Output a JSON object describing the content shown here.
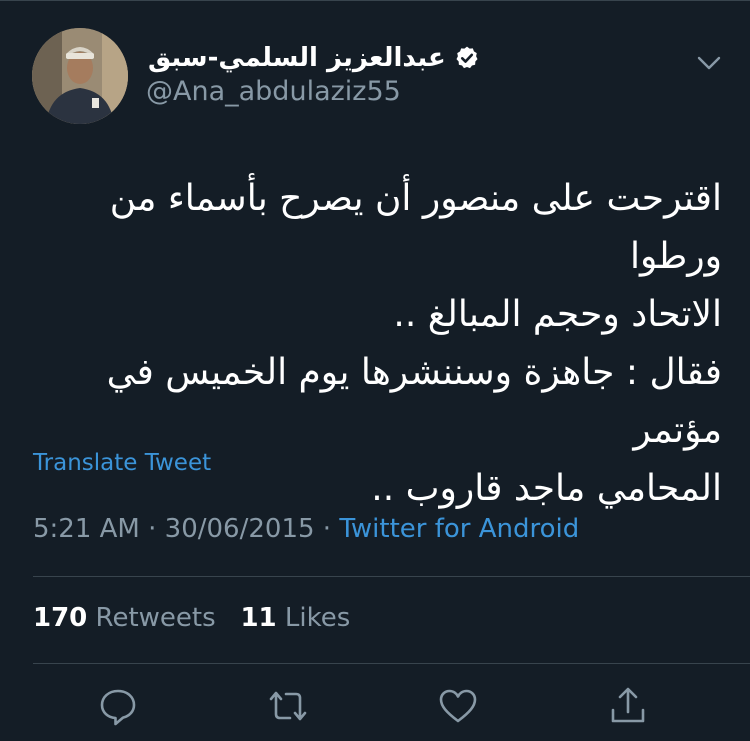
{
  "colors": {
    "background": "#141d26",
    "text": "#ffffff",
    "secondary_text": "#8899a6",
    "link": "#3b94d9",
    "divider": "#38444d"
  },
  "author": {
    "display_name": "عبدالعزيز السلمي-سبق",
    "handle": "@Ana_abdulaziz55",
    "verified": true,
    "avatar_icon": "profile-photo"
  },
  "tweet": {
    "text": "اقترحت على منصور أن يصرح بأسماء من ورطوا\nالاتحاد وحجم المبالغ ..\nفقال : جاهزة وسننشرها يوم الخميس في مؤتمر\nالمحامي ماجد قاروب ..",
    "translate_label": "Translate Tweet",
    "time": "5:21 AM",
    "separator": "·",
    "date": "30/06/2015",
    "source": "Twitter for Android"
  },
  "stats": {
    "retweets_count": "170",
    "retweets_label": "Retweets",
    "likes_count": "11",
    "likes_label": "Likes"
  },
  "actions": [
    {
      "icon": "reply-icon"
    },
    {
      "icon": "retweet-icon"
    },
    {
      "icon": "like-icon"
    },
    {
      "icon": "share-icon"
    }
  ]
}
